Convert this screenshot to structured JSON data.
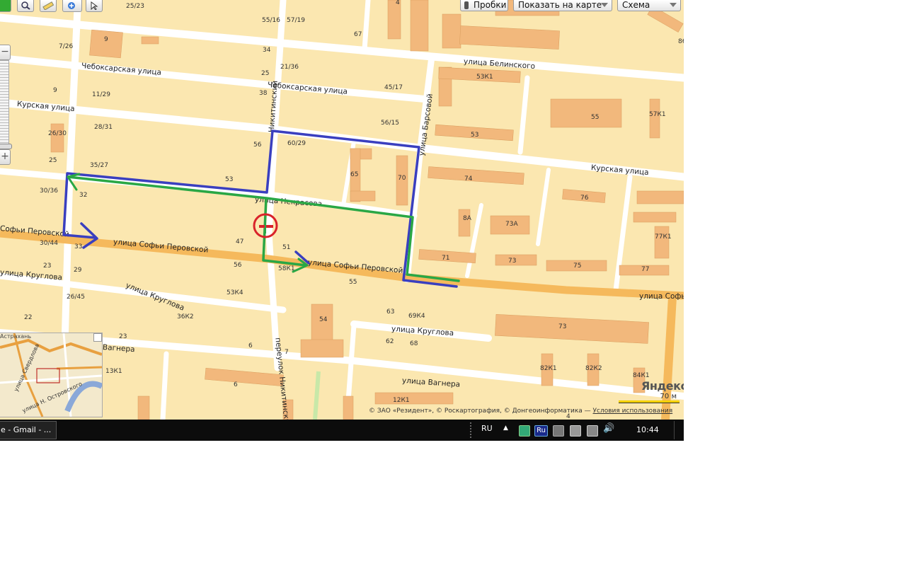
{
  "toolbar": {
    "traffic_label": "Пробки",
    "show_on_map_label": "Показать на карте",
    "map_type_label": "Схема"
  },
  "streets": {
    "chebok_1": "Чебоксарская улица",
    "chebok_2": "Чебоксарская улица",
    "kurskaya_1": "Курская улица",
    "kurskaya_2": "Курская улица",
    "belinskogo": "улица Белинского",
    "barsovoy": "улица Барсовой",
    "nikitinsky_top": "Никитинский",
    "nikitinsky_lane": "переулок Никитинский",
    "sofi_1": "Софьи Перовской",
    "sofi_2": "улица Софьи Перовской",
    "sofi_3": "улица Софьи Перовской",
    "sofi_4": "улица Софьи",
    "kruglova_1": "улица Круглова",
    "kruglova_2": "улица Круглова",
    "kruglova_3": "улица Круглова",
    "vagnera_1": "Вагнера",
    "vagnera_2": "улица Вагнера",
    "nekrasova": "улица Некрасова",
    "sverdlova": "улица Свердлова",
    "n_ostrovskogo": "улица Н. Островского",
    "astrakhan": "Астрахань"
  },
  "houses": [
    "25/23",
    "55/16",
    "57/19",
    "4",
    "86",
    "9",
    "67",
    "7/26",
    "34",
    "21/36",
    "25",
    "45/17",
    "53К1",
    "9",
    "11/29",
    "38",
    "55",
    "57К1",
    "26/30",
    "28/31",
    "56/15",
    "53",
    "56",
    "60/29",
    "25",
    "35/27",
    "65",
    "70",
    "74",
    "30/36",
    "32",
    "53",
    "76",
    "8А",
    "73А",
    "30/44",
    "33",
    "47",
    "51",
    "77К1",
    "23",
    "29",
    "56",
    "58К1",
    "71",
    "73",
    "75",
    "77",
    "26/45",
    "53К4",
    "55",
    "63",
    "69К4",
    "22",
    "36К2",
    "54",
    "73",
    "23",
    "6",
    "62",
    "68",
    "13К1",
    "7",
    "82К1",
    "82К2",
    "84К1",
    "6",
    "12К1",
    "4"
  ],
  "route": {
    "blue_color": "#3a3fbf",
    "green_color": "#2aa745",
    "marker_color": "#d9232a"
  },
  "copyright": {
    "text": "© ЗАО «Резидент», © Роскартография, © Донгеоинформатика — ",
    "terms_link": "Условия использования"
  },
  "logo": "Яндекс",
  "scale_label": "70 м",
  "taskbar": {
    "task_label": "e - Gmail - ...",
    "language": "RU",
    "lang_indicator": "Ru",
    "clock": "10:44"
  }
}
